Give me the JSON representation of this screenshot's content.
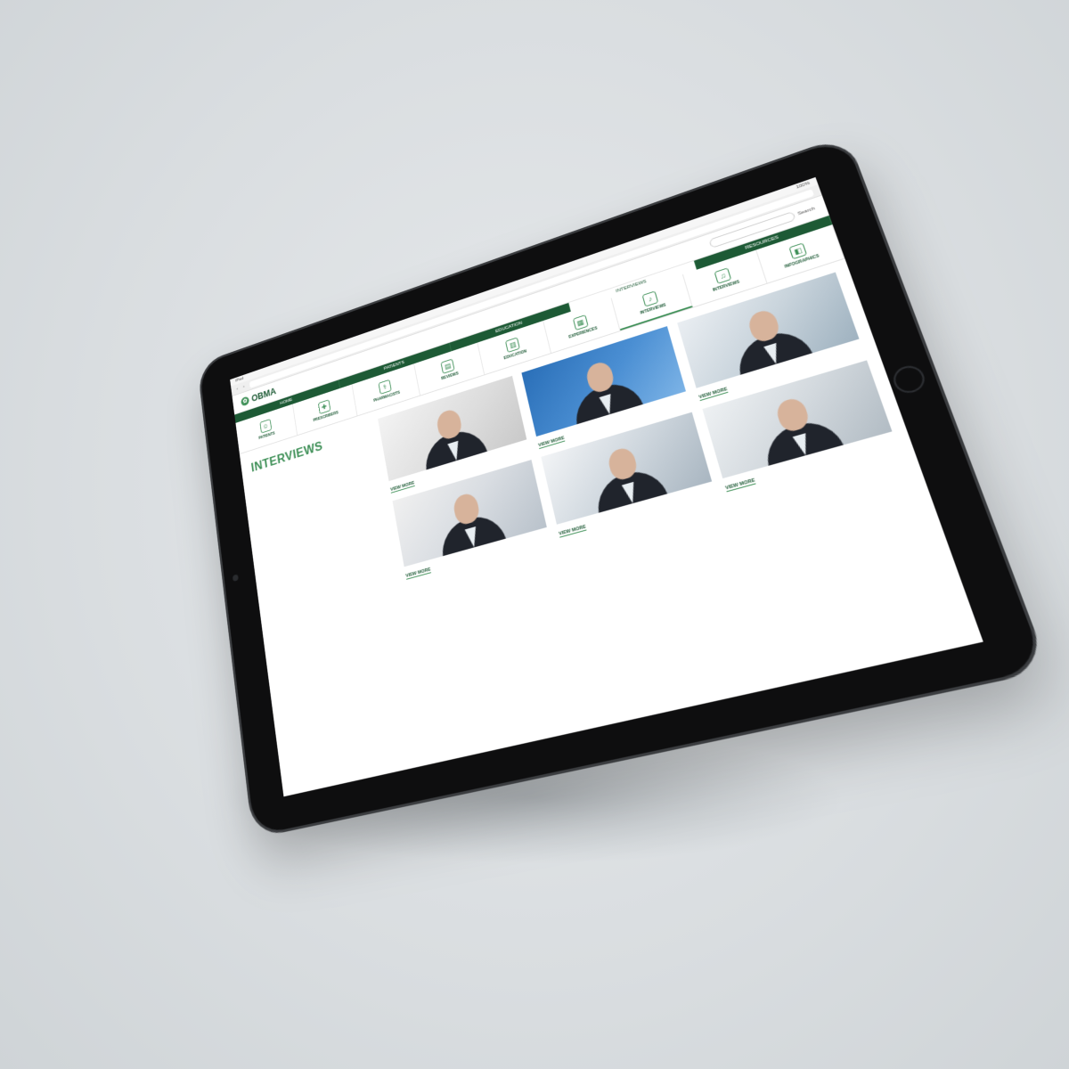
{
  "browser": {
    "status_left": "iPad",
    "status_right": "100%",
    "url": "",
    "nav_back": "‹",
    "nav_forward": "›"
  },
  "site": {
    "logo_text": "OBMA",
    "search_placeholder": "",
    "search_button": "Search"
  },
  "topnav": [
    {
      "label": "Home",
      "active": false
    },
    {
      "label": "Patients",
      "active": false
    },
    {
      "label": "Education",
      "active": false
    },
    {
      "label": "Interviews",
      "active": true
    },
    {
      "label": "Resources",
      "active": false
    }
  ],
  "subnav": [
    {
      "label": "Patients",
      "icon": "person-icon"
    },
    {
      "label": "Prescribers",
      "icon": "doctor-icon"
    },
    {
      "label": "Pharmacists",
      "icon": "pharmacist-icon"
    },
    {
      "label": "Reviews",
      "icon": "document-icon"
    },
    {
      "label": "Education",
      "icon": "book-icon"
    },
    {
      "label": "Experiences",
      "icon": "chart-icon"
    },
    {
      "label": "Interviews",
      "icon": "microphone-icon",
      "active": true
    },
    {
      "label": "Interviews",
      "icon": "mic-icon"
    },
    {
      "label": "Infographics",
      "icon": "infographic-icon"
    }
  ],
  "page": {
    "title": "INTERVIEWS",
    "intro": "",
    "lead": "",
    "subhead": "",
    "bullets": []
  },
  "cards": [
    {
      "name": "",
      "role": "",
      "desc": "",
      "button": "VIEW MORE"
    },
    {
      "name": "",
      "role": "",
      "desc": "",
      "button": "VIEW MORE"
    },
    {
      "name": "",
      "role": "",
      "desc": "",
      "button": "VIEW MORE"
    },
    {
      "name": "",
      "role": "",
      "desc": "",
      "button": "VIEW MORE"
    },
    {
      "name": "",
      "role": "",
      "desc": "",
      "button": "VIEW MORE"
    },
    {
      "name": "",
      "role": "",
      "desc": "",
      "button": "VIEW MORE"
    }
  ],
  "colors": {
    "brand_dark_green": "#1d5a35",
    "brand_green": "#3d8f56",
    "bezel": "#0e0e0f",
    "background": "#d9dde0"
  }
}
